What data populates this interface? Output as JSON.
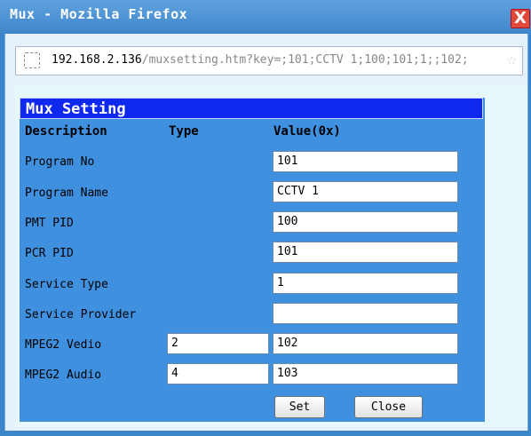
{
  "window": {
    "title": "Mux - Mozilla Firefox",
    "close_label": "X"
  },
  "urlbar": {
    "host": "192.168.2.136",
    "path": "/muxsetting.htm?key=;101;CCTV 1;100;101;1;;102;"
  },
  "panel": {
    "title": "Mux Setting",
    "headers": {
      "description": "Description",
      "type": "Type",
      "value": "Value(0x)"
    },
    "rows": [
      {
        "label": "Program No",
        "value": "101"
      },
      {
        "label": "Program Name",
        "value": "CCTV 1"
      },
      {
        "label": "PMT PID",
        "value": "100"
      },
      {
        "label": "PCR PID",
        "value": "101"
      },
      {
        "label": "Service Type",
        "value": "1"
      },
      {
        "label": "Service Provider",
        "value": ""
      },
      {
        "label": "MPEG2 Vedio",
        "type": "2",
        "value": "102"
      },
      {
        "label": "MPEG2 Audio",
        "type": "4",
        "value": "103"
      }
    ],
    "buttons": {
      "set": "Set",
      "close": "Close"
    }
  }
}
